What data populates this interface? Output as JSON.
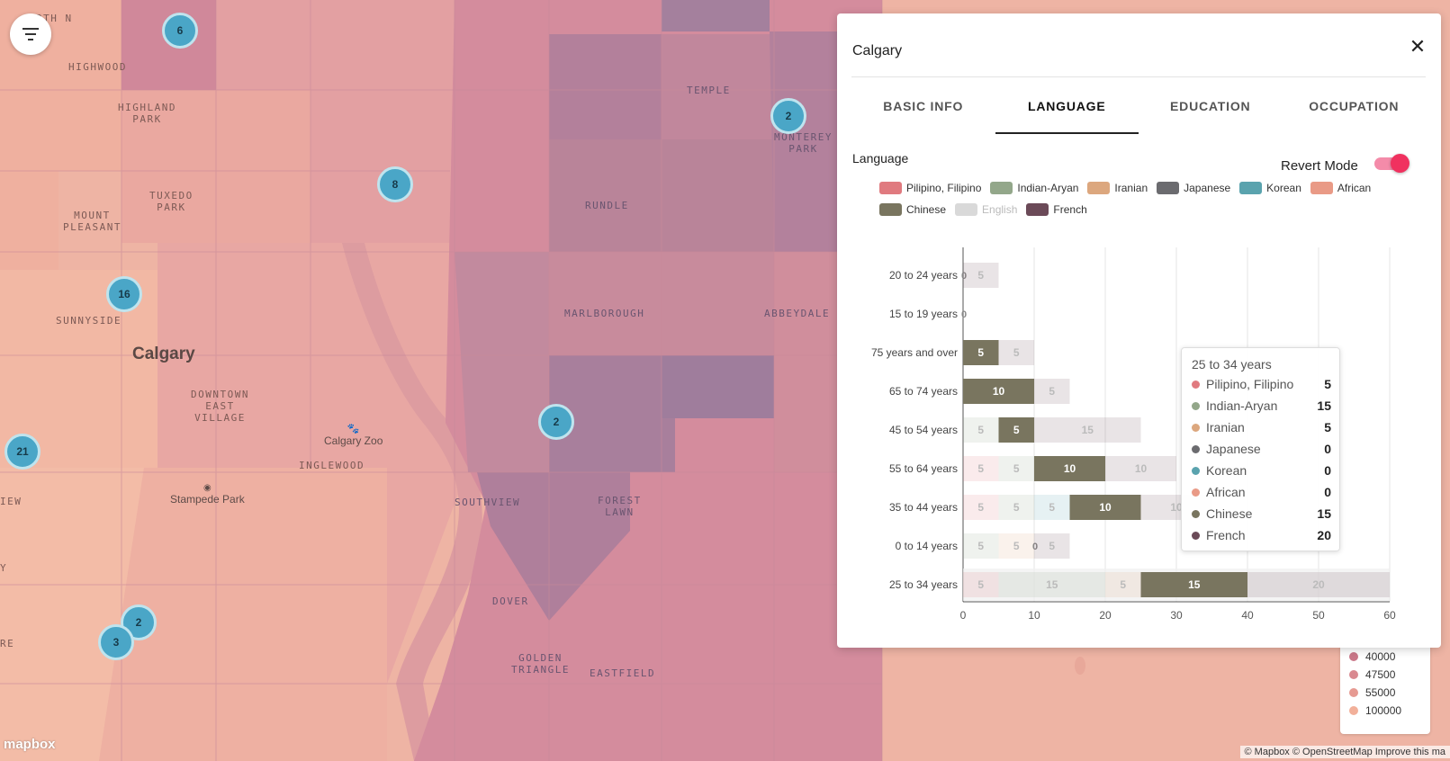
{
  "map": {
    "city": "Calgary",
    "neighborhoods": [
      {
        "name": "RTH\nN",
        "tone": "light"
      },
      {
        "name": "HIGHWOOD",
        "tone": "light"
      },
      {
        "name": "HIGHLAND\nPARK",
        "tone": "light"
      },
      {
        "name": "TUXEDO\nPARK",
        "tone": "light"
      },
      {
        "name": "MOUNT\nPLEASANT",
        "tone": "light"
      },
      {
        "name": "SUNNYSIDE",
        "tone": "light"
      },
      {
        "name": "DOWNTOWN\nEAST\nVILLAGE",
        "tone": "light"
      },
      {
        "name": "INGLEWOOD",
        "tone": "light"
      },
      {
        "name": "TEMPLE",
        "tone": "dark"
      },
      {
        "name": "MONTEREY\nPARK",
        "tone": "dark"
      },
      {
        "name": "RUNDLE",
        "tone": "dark"
      },
      {
        "name": "MARLBOROUGH",
        "tone": "dark"
      },
      {
        "name": "ABBEYDALE",
        "tone": "dark"
      },
      {
        "name": "SOUTHVIEW",
        "tone": "dark"
      },
      {
        "name": "FOREST\nLAWN",
        "tone": "dark"
      },
      {
        "name": "DOVER",
        "tone": "dark"
      },
      {
        "name": "GOLDEN\nTRIANGLE",
        "tone": "dark"
      },
      {
        "name": "EASTFIELD",
        "tone": "dark"
      },
      {
        "name": "IEW",
        "tone": "light"
      },
      {
        "name": "RE",
        "tone": "light"
      },
      {
        "name": "Y",
        "tone": "light"
      }
    ],
    "pois": [
      "Calgary Zoo",
      "Stampede Park"
    ],
    "clusters": [
      "6",
      "8",
      "16",
      "21",
      "2",
      "2",
      "2",
      "3"
    ],
    "attribution": "© Mapbox © OpenStreetMap Improve this ma",
    "logo": "mapbox",
    "income_legend": [
      {
        "label": "40000",
        "color": "#c97788"
      },
      {
        "label": "47500",
        "color": "#d98990"
      },
      {
        "label": "55000",
        "color": "#e69a92"
      },
      {
        "label": "100000",
        "color": "#f2b09a"
      }
    ]
  },
  "icons": {
    "filter": "filter-icon",
    "close": "close-icon"
  },
  "panel": {
    "title": "Calgary",
    "close_glyph": "✕",
    "tabs": [
      {
        "label": "BASIC INFO",
        "active": false
      },
      {
        "label": "LANGUAGE",
        "active": true
      },
      {
        "label": "EDUCATION",
        "active": false
      },
      {
        "label": "OCCUPATION",
        "active": false
      }
    ],
    "section_label": "Language",
    "revert_mode_label": "Revert Mode",
    "revert_mode_on": true
  },
  "chart_data": {
    "type": "bar",
    "stacked": true,
    "orientation": "horizontal",
    "categories": [
      "20 to 24 years",
      "15 to 19 years",
      "75 years and over",
      "65 to 74 years",
      "45 to 54 years",
      "55 to 64 years",
      "35 to 44 years",
      "0 to 14 years",
      "25 to 34 years"
    ],
    "series": [
      {
        "name": "Pilipino, Filipino",
        "color": "#e07a7f",
        "values": [
          0,
          0,
          0,
          0,
          0,
          5,
          5,
          0,
          5
        ]
      },
      {
        "name": "Indian-Aryan",
        "color": "#93a78a",
        "values": [
          0,
          0,
          0,
          0,
          5,
          5,
          5,
          5,
          15
        ]
      },
      {
        "name": "Iranian",
        "color": "#dca77e",
        "values": [
          0,
          0,
          0,
          0,
          0,
          0,
          0,
          5,
          5
        ]
      },
      {
        "name": "Japanese",
        "color": "#6b6b6f",
        "values": [
          0,
          0,
          0,
          0,
          0,
          0,
          0,
          0,
          0
        ]
      },
      {
        "name": "Korean",
        "color": "#5aa3ae",
        "values": [
          0,
          0,
          0,
          0,
          0,
          0,
          5,
          0,
          0
        ]
      },
      {
        "name": "African",
        "color": "#e99a86",
        "values": [
          0,
          0,
          0,
          0,
          0,
          0,
          0,
          0,
          0
        ]
      },
      {
        "name": "Chinese",
        "color": "#79755f",
        "values": [
          0,
          0,
          5,
          10,
          5,
          10,
          10,
          0,
          15
        ]
      },
      {
        "name": "English",
        "color": "#cccccc",
        "hidden": true,
        "values": [
          0,
          0,
          0,
          0,
          0,
          0,
          0,
          0,
          0
        ]
      },
      {
        "name": "French",
        "color": "#6b4a58",
        "values": [
          5,
          0,
          5,
          5,
          15,
          10,
          10,
          5,
          20
        ]
      }
    ],
    "highlighted_series": "Chinese",
    "x_ticks": [
      0,
      10,
      20,
      30,
      40,
      50,
      60
    ],
    "xlim": [
      0,
      60
    ],
    "grid": true,
    "legend_position": "top"
  },
  "tooltip": {
    "title": "25 to 34 years",
    "rows": [
      {
        "name": "Pilipino, Filipino",
        "value": "5",
        "color": "#e07a7f"
      },
      {
        "name": "Indian-Aryan",
        "value": "15",
        "color": "#93a78a"
      },
      {
        "name": "Iranian",
        "value": "5",
        "color": "#dca77e"
      },
      {
        "name": "Japanese",
        "value": "0",
        "color": "#6b6b6f"
      },
      {
        "name": "Korean",
        "value": "0",
        "color": "#5aa3ae"
      },
      {
        "name": "African",
        "value": "0",
        "color": "#e99a86"
      },
      {
        "name": "Chinese",
        "value": "15",
        "color": "#79755f"
      },
      {
        "name": "French",
        "value": "20",
        "color": "#6b4a58"
      }
    ]
  }
}
